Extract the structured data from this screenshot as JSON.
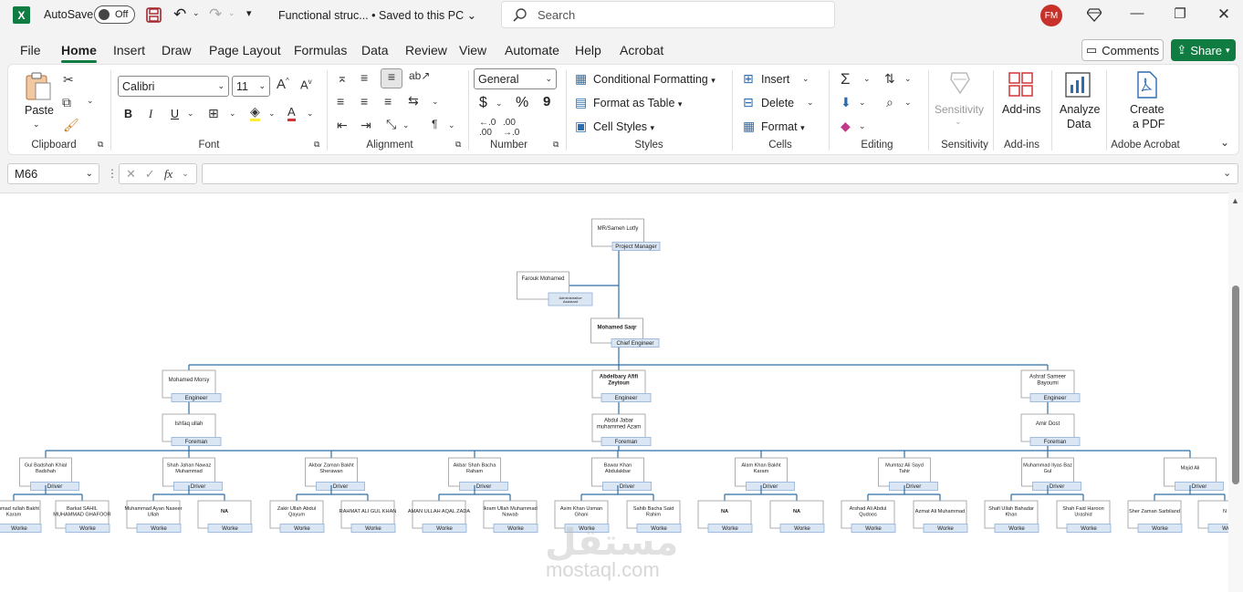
{
  "titlebar": {
    "autosave_label": "AutoSave",
    "autosave_state": "Off",
    "doc_title": "Functional struc...",
    "save_status": "•  Saved to this PC",
    "search_placeholder": "Search",
    "user_initials": "FM"
  },
  "menu": {
    "tabs": [
      "File",
      "Home",
      "Insert",
      "Draw",
      "Page Layout",
      "Formulas",
      "Data",
      "Review",
      "View",
      "Automate",
      "Help",
      "Acrobat"
    ],
    "active": "Home",
    "comments": "Comments",
    "share": "Share"
  },
  "ribbon": {
    "clipboard": {
      "label": "Clipboard",
      "paste": "Paste"
    },
    "font": {
      "label": "Font",
      "name": "Calibri",
      "size": "11",
      "bold": "B",
      "italic": "I",
      "underline": "U"
    },
    "alignment": {
      "label": "Alignment"
    },
    "number": {
      "label": "Number",
      "format": "General",
      "currency": "$",
      "percent": "%",
      "comma": "9"
    },
    "styles": {
      "label": "Styles",
      "conditional": "Conditional Formatting",
      "table": "Format as Table",
      "cell_styles": "Cell Styles"
    },
    "cells": {
      "label": "Cells",
      "insert": "Insert",
      "delete": "Delete",
      "format": "Format"
    },
    "editing": {
      "label": "Editing"
    },
    "sensitivity": {
      "label": "Sensitivity",
      "btn": "Sensitivity"
    },
    "addins": {
      "label": "Add-ins",
      "btn": "Add-ins"
    },
    "analyze": {
      "btn1": "Analyze",
      "btn2": "Data"
    },
    "acrobat": {
      "label": "Adobe Acrobat",
      "btn1": "Create",
      "btn2": "a PDF"
    }
  },
  "formula_bar": {
    "cell_ref": "M66",
    "fx": "fx",
    "content": ""
  },
  "org": {
    "pm": {
      "name": "MR/Sameh Lotfy",
      "role": "Project Manager"
    },
    "admin": {
      "name": "Farouk Mohamed",
      "role": "Administrative Assistant"
    },
    "chief": {
      "name": "Mohamed Saqr",
      "role": "Chief Engineer"
    },
    "engineers": [
      {
        "name": "Mohamed Morsy",
        "role": "Engineer"
      },
      {
        "name": "Abdelbary Afifi Zeytoun",
        "role": "Engineer"
      },
      {
        "name": "Ashraf Sameer Bayoumi",
        "role": "Engineer"
      }
    ],
    "foremen": [
      {
        "name": "Ishfaq ullah",
        "role": "Foreman"
      },
      {
        "name": "Abdul Jabar muhammed Azam",
        "role": "Foreman"
      },
      {
        "name": "Amir Dost",
        "role": "Foreman"
      }
    ],
    "drivers": [
      {
        "name": "Gul Badshah Khial Badshah",
        "role": "Driver"
      },
      {
        "name": "Shah Jahan Nawaz Muhammad",
        "role": "Driver"
      },
      {
        "name": "Akbar Zaman Bakht Sherawan",
        "role": "Driver"
      },
      {
        "name": "Akbar Shah Bacha Raham",
        "role": "Driver"
      },
      {
        "name": "Bawar Khan Abdulakbar",
        "role": "Driver"
      },
      {
        "name": "Alam Khan Bakht Karam",
        "role": "Driver"
      },
      {
        "name": "Mumtaz Ali Sayd Tahir",
        "role": "Driver"
      },
      {
        "name": "Muhammad Ilyas Baz Gul",
        "role": "Driver"
      },
      {
        "name": "Majid Ali",
        "role": "Driver"
      }
    ],
    "workers": [
      {
        "name": "uhammad rullah Bakht Karam",
        "role": "Worke"
      },
      {
        "name": "Barkat SAHIL MUHAMMAD GHAFOOR",
        "role": "Worke"
      },
      {
        "name": "Muhammad Ayan Naseer Ullah",
        "role": "Worke"
      },
      {
        "name": "NA",
        "role": "Worke"
      },
      {
        "name": "Zakir Ullah Abdul Qayum",
        "role": "Worke"
      },
      {
        "name": "RAHMAT ALI GUL KHAN",
        "role": "Worke"
      },
      {
        "name": "AMAN ULLAH AQAL ZADA",
        "role": "Worke"
      },
      {
        "name": "Ikram Ullah Muhammad Nawab",
        "role": "Worke"
      },
      {
        "name": "Asim Khan Usman Ghani",
        "role": "Worke"
      },
      {
        "name": "Sahib Bacha Said Rahim",
        "role": "Worke"
      },
      {
        "name": "NA",
        "role": "Worke"
      },
      {
        "name": "NA",
        "role": "Worke"
      },
      {
        "name": "Arshad Ali Abdul Qudoos",
        "role": "Worke"
      },
      {
        "name": "Azmat Ali Muhammad",
        "role": "Worke"
      },
      {
        "name": "Shafi Ullah Bahadar Khan",
        "role": "Worke"
      },
      {
        "name": "Shah Faid Haroon Urashid",
        "role": "Worke"
      },
      {
        "name": "Sher Zaman Sarbiland",
        "role": "Worke"
      },
      {
        "name": "N",
        "role": "Worke"
      }
    ]
  },
  "watermark": {
    "arabic": "مستقل",
    "latin": "mostaql.com"
  },
  "colors": {
    "excel_green": "#107c41",
    "role_fill": "#dbe6f4",
    "role_border": "#8fb0d8",
    "line": "#2e6da4",
    "avatar": "#c8312a"
  }
}
